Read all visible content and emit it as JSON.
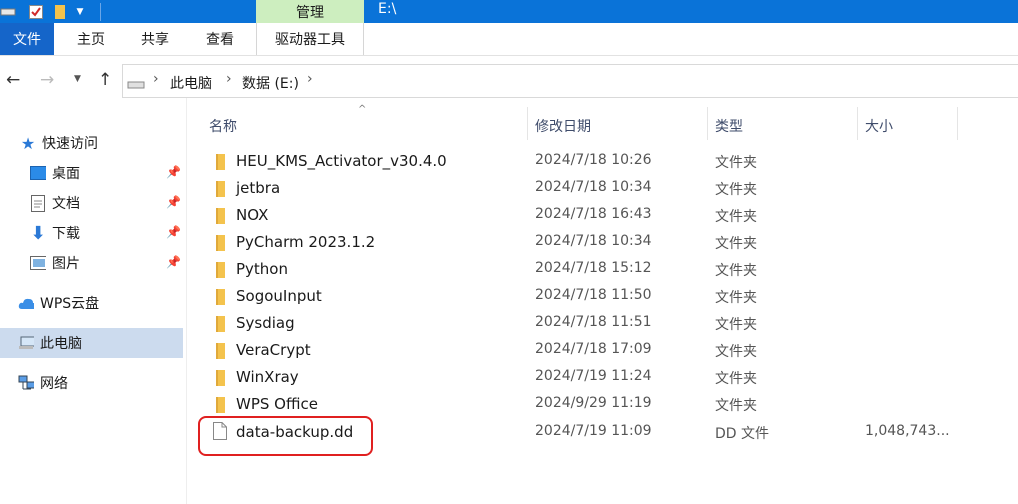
{
  "titlebar": {
    "context_tab": "管理",
    "path": "E:\\"
  },
  "ribbon": {
    "tabs": [
      "文件",
      "主页",
      "共享",
      "查看",
      "驱动器工具"
    ]
  },
  "address": {
    "crumbs": [
      "此电脑",
      "数据 (E:)"
    ]
  },
  "nav": {
    "quick_access": "快速访问",
    "items": [
      "桌面",
      "文档",
      "下载",
      "图片"
    ],
    "wps": "WPS云盘",
    "this_pc": "此电脑",
    "network": "网络"
  },
  "columns": {
    "name": "名称",
    "date": "修改日期",
    "type": "类型",
    "size": "大小"
  },
  "files": [
    {
      "name": "HEU_KMS_Activator_v30.4.0",
      "date": "2024/7/18 10:26",
      "type": "文件夹",
      "size": "",
      "kind": "folder"
    },
    {
      "name": "jetbra",
      "date": "2024/7/18 10:34",
      "type": "文件夹",
      "size": "",
      "kind": "folder"
    },
    {
      "name": "NOX",
      "date": "2024/7/18 16:43",
      "type": "文件夹",
      "size": "",
      "kind": "folder"
    },
    {
      "name": "PyCharm 2023.1.2",
      "date": "2024/7/18 10:34",
      "type": "文件夹",
      "size": "",
      "kind": "folder"
    },
    {
      "name": "Python",
      "date": "2024/7/18 15:12",
      "type": "文件夹",
      "size": "",
      "kind": "folder"
    },
    {
      "name": "SogouInput",
      "date": "2024/7/18 11:50",
      "type": "文件夹",
      "size": "",
      "kind": "folder"
    },
    {
      "name": "Sysdiag",
      "date": "2024/7/18 11:51",
      "type": "文件夹",
      "size": "",
      "kind": "folder"
    },
    {
      "name": "VeraCrypt",
      "date": "2024/7/18 17:09",
      "type": "文件夹",
      "size": "",
      "kind": "folder"
    },
    {
      "name": "WinXray",
      "date": "2024/7/19 11:24",
      "type": "文件夹",
      "size": "",
      "kind": "folder"
    },
    {
      "name": "WPS Office",
      "date": "2024/9/29 11:19",
      "type": "文件夹",
      "size": "",
      "kind": "folder"
    },
    {
      "name": "data-backup.dd",
      "date": "2024/7/19 11:09",
      "type": "DD 文件",
      "size": "1,048,743...",
      "kind": "file"
    }
  ],
  "colors": {
    "titlebar": "#0a73d8",
    "context_tab": "#cdeebf",
    "file_tab": "#1565c9",
    "selected_nav": "#ccdbee",
    "folder": "#f4c34d",
    "highlight": "#e02020"
  }
}
